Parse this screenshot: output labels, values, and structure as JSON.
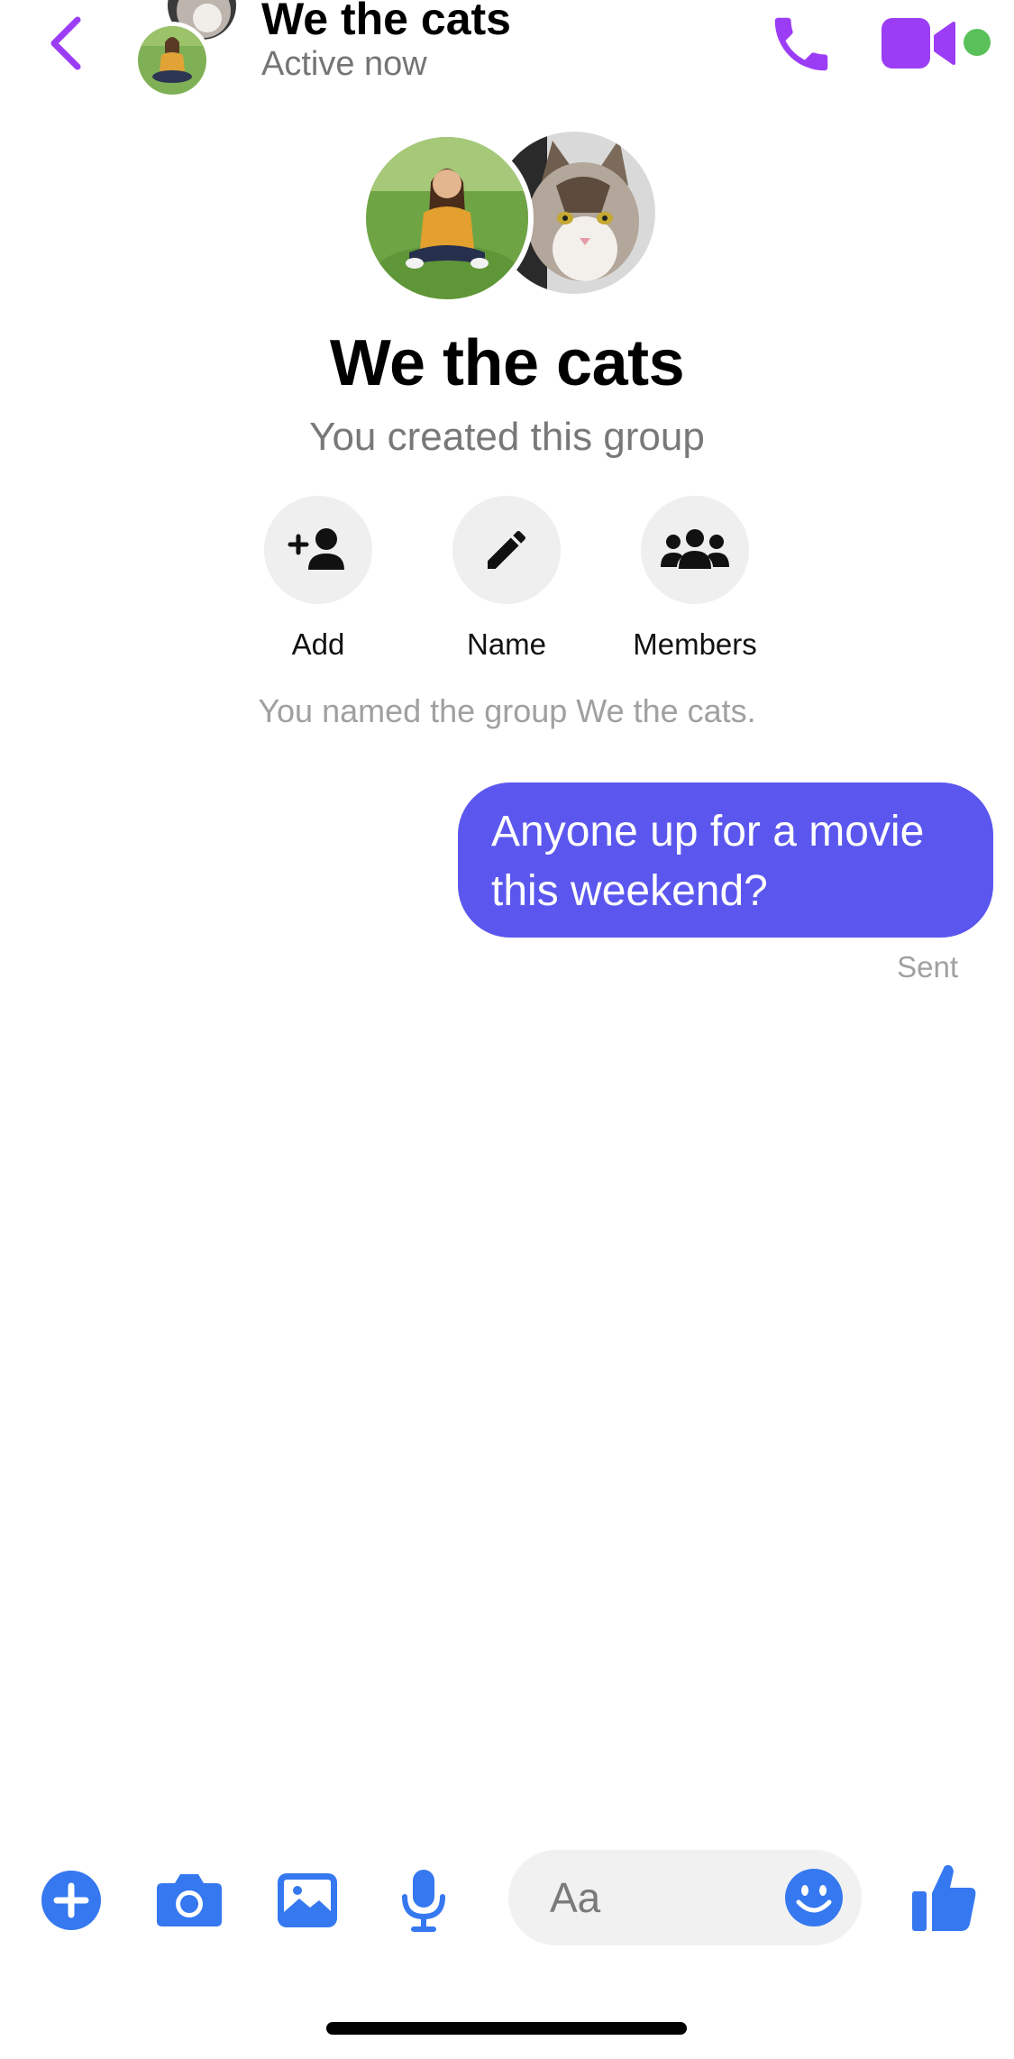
{
  "header": {
    "title": "We the cats",
    "status": "Active now",
    "back_icon": "chevron-left-icon",
    "call_icon": "phone-icon",
    "video_icon": "video-camera-icon",
    "accent_color": "#9b3df5",
    "online_color": "#5ac05a"
  },
  "group": {
    "name": "We the cats",
    "subtitle": "You created this group",
    "actions": [
      {
        "label": "Add",
        "icon": "add-person-icon"
      },
      {
        "label": "Name",
        "icon": "pencil-icon"
      },
      {
        "label": "Members",
        "icon": "group-people-icon"
      }
    ]
  },
  "thread": {
    "system_message": "You named the group We the cats.",
    "messages": [
      {
        "text": "Anyone up for a movie this weekend?",
        "status": "Sent",
        "bubble_color": "#5b57ee"
      }
    ]
  },
  "composer": {
    "placeholder": "Aa",
    "icons": [
      "plus-icon",
      "camera-icon",
      "image-icon",
      "microphone-icon",
      "emoji-icon",
      "thumbs-up-icon"
    ],
    "icon_color": "#3578f0"
  }
}
